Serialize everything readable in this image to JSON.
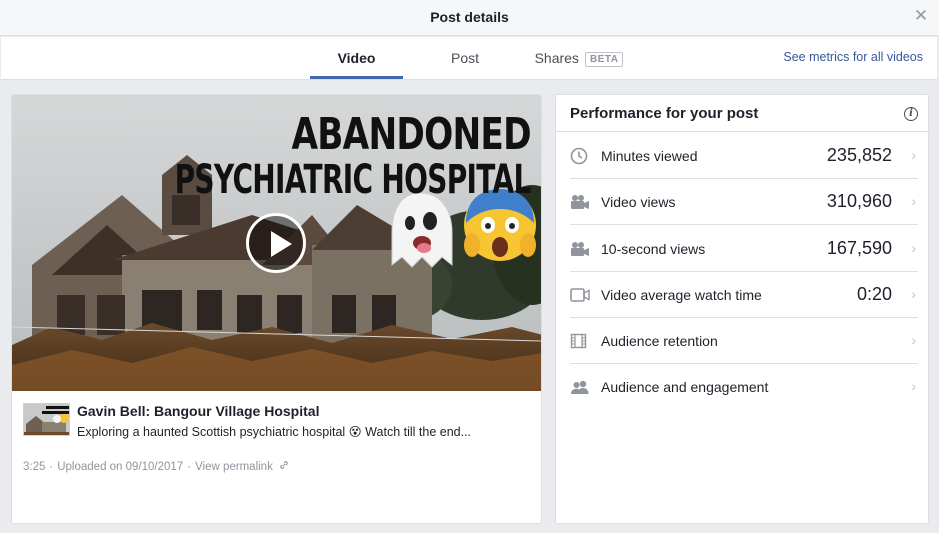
{
  "dialog": {
    "title": "Post details",
    "close_icon": "close-icon"
  },
  "tabs": [
    {
      "label": "Video",
      "active": true
    },
    {
      "label": "Post",
      "active": false
    },
    {
      "label": "Shares",
      "active": false,
      "badge": "BETA"
    }
  ],
  "see_metrics_link": "See metrics for all videos",
  "video": {
    "thumbnail_title_line1": "ABANDONED",
    "thumbnail_title_line2": "PSYCHIATRIC HOSPITAL",
    "thumbnail_emojis": "👻😱",
    "mini_thumb_text": "ABANDONED PSYCHIATRIC HOSPITAL",
    "title": "Gavin Bell: Bangour Village Hospital",
    "description": "Exploring a haunted Scottish psychiatric hospital 😵  Watch till the end...",
    "duration": "3:25",
    "uploaded": "Uploaded on 09/10/2017",
    "permalink": "View permalink",
    "separator": "·"
  },
  "performance": {
    "title": "Performance for your post",
    "metrics": [
      {
        "icon": "clock-icon",
        "label": "Minutes viewed",
        "value": "235,852"
      },
      {
        "icon": "video-camera-icon",
        "label": "Video views",
        "value": "310,960"
      },
      {
        "icon": "video-camera-icon",
        "label": "10-second views",
        "value": "167,590"
      },
      {
        "icon": "video-outline-icon",
        "label": "Video average watch time",
        "value": "0:20"
      },
      {
        "icon": "film-strip-icon",
        "label": "Audience retention",
        "value": ""
      },
      {
        "icon": "people-icon",
        "label": "Audience and engagement",
        "value": ""
      }
    ]
  },
  "colors": {
    "accent": "#4267b2",
    "link": "#365899",
    "muted": "#90949c",
    "background": "#e9ebee"
  }
}
